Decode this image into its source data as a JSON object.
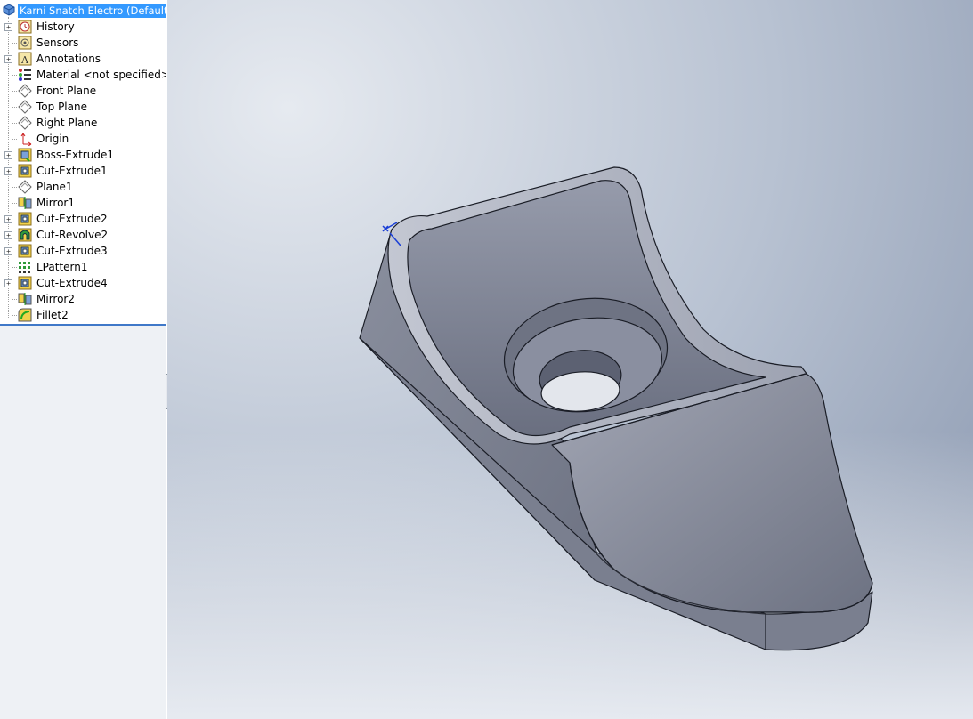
{
  "tree": {
    "root_label": "Karni Snatch Electro  (Default<",
    "items": [
      {
        "label": "History",
        "icon": "history-icon",
        "expandable": true
      },
      {
        "label": "Sensors",
        "icon": "sensors-icon",
        "expandable": false
      },
      {
        "label": "Annotations",
        "icon": "annotations-icon",
        "expandable": true
      },
      {
        "label": "Material <not specified>",
        "icon": "material-icon",
        "expandable": false
      },
      {
        "label": "Front Plane",
        "icon": "plane-icon",
        "expandable": false
      },
      {
        "label": "Top Plane",
        "icon": "plane-icon",
        "expandable": false
      },
      {
        "label": "Right Plane",
        "icon": "plane-icon",
        "expandable": false
      },
      {
        "label": "Origin",
        "icon": "origin-icon",
        "expandable": false
      },
      {
        "label": "Boss-Extrude1",
        "icon": "boss-extrude-icon",
        "expandable": true
      },
      {
        "label": "Cut-Extrude1",
        "icon": "cut-extrude-icon",
        "expandable": true
      },
      {
        "label": "Plane1",
        "icon": "plane-icon",
        "expandable": false
      },
      {
        "label": "Mirror1",
        "icon": "mirror-icon",
        "expandable": false
      },
      {
        "label": "Cut-Extrude2",
        "icon": "cut-extrude-icon",
        "expandable": true
      },
      {
        "label": "Cut-Revolve2",
        "icon": "cut-revolve-icon",
        "expandable": true
      },
      {
        "label": "Cut-Extrude3",
        "icon": "cut-extrude-icon",
        "expandable": true
      },
      {
        "label": "LPattern1",
        "icon": "linear-pattern-icon",
        "expandable": false
      },
      {
        "label": "Cut-Extrude4",
        "icon": "cut-extrude-icon",
        "expandable": true
      },
      {
        "label": "Mirror2",
        "icon": "mirror-icon",
        "expandable": false
      },
      {
        "label": "Fillet2",
        "icon": "fillet-icon",
        "expandable": false
      }
    ]
  },
  "colors": {
    "selection": "#3399ff",
    "viewport_light": "#e4e8ef",
    "viewport_dark": "#8f9cb3",
    "part_face": "#7b8090"
  }
}
